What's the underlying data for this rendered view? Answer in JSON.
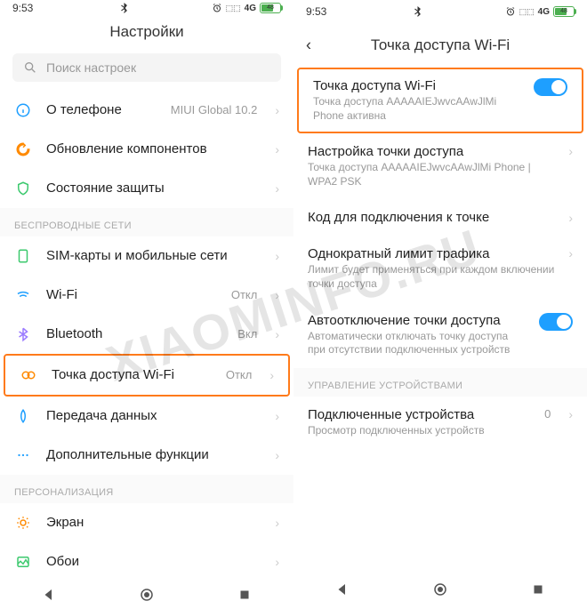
{
  "status": {
    "time": "9:53",
    "net": "4G",
    "battery": "48"
  },
  "left": {
    "title": "Настройки",
    "search_placeholder": "Поиск настроек",
    "about": {
      "label": "О телефоне",
      "value": "MIUI Global 10.2"
    },
    "update": "Обновление компонентов",
    "security": "Состояние защиты",
    "section_wireless": "БЕСПРОВОДНЫЕ СЕТИ",
    "sim": "SIM-карты и мобильные сети",
    "wifi": {
      "label": "Wi-Fi",
      "value": "Откл"
    },
    "bt": {
      "label": "Bluetooth",
      "value": "Вкл"
    },
    "hotspot": {
      "label": "Точка доступа Wi-Fi",
      "value": "Откл"
    },
    "data": "Передача данных",
    "more": "Дополнительные функции",
    "section_personal": "ПЕРСОНАЛИЗАЦИЯ",
    "display": "Экран",
    "wallpaper": "Обои"
  },
  "right": {
    "title": "Точка доступа Wi-Fi",
    "hotspot": {
      "title": "Точка доступа Wi-Fi",
      "sub": "Точка доступа AAAAAIEJwvcAAwJlMi Phone активна"
    },
    "setup": {
      "title": "Настройка точки доступа",
      "sub": "Точка доступа AAAAAIEJwvcAAwJlMi Phone | WPA2 PSK"
    },
    "code": "Код для подключения к точке",
    "limit": {
      "title": "Однократный лимит трафика",
      "sub": "Лимит будет применяться при каждом включении точки доступа"
    },
    "auto_off": {
      "title": "Автоотключение точки доступа",
      "sub": "Автоматически отключать точку доступа при отсутствии подключенных устройств"
    },
    "section_devices": "УПРАВЛЕНИЕ УСТРОЙСТВАМИ",
    "devices": {
      "title": "Подключенные устройства",
      "sub": "Просмотр подключенных устройств",
      "count": "0"
    }
  },
  "watermark": "XIAOMINFO.RU"
}
